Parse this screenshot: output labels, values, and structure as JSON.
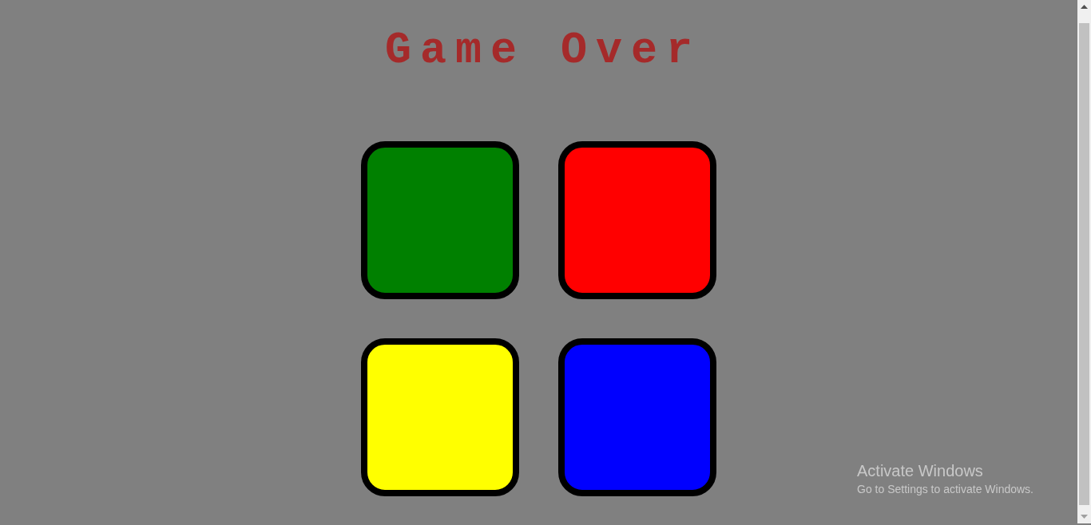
{
  "title": "Game Over",
  "pads": [
    {
      "color": "#008000"
    },
    {
      "color": "#ff0000"
    },
    {
      "color": "#ffff00"
    },
    {
      "color": "#0000ff"
    }
  ],
  "activation_notice": {
    "heading": "Activate Windows",
    "text": "Go to Settings to activate Windows."
  }
}
